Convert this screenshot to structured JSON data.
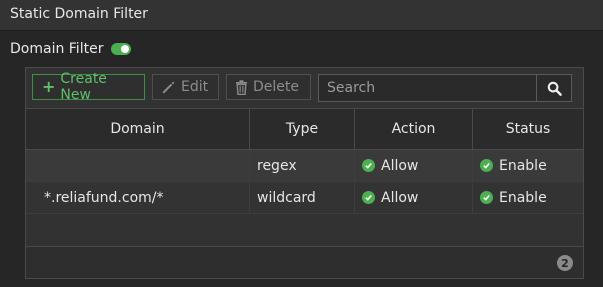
{
  "section": {
    "title": "Static Domain Filter"
  },
  "filter": {
    "label": "Domain Filter",
    "enabled": true
  },
  "toolbar": {
    "create_label": "Create New",
    "edit_label": "Edit",
    "delete_label": "Delete"
  },
  "search": {
    "placeholder": "Search",
    "value": ""
  },
  "table": {
    "columns": [
      "Domain",
      "Type",
      "Action",
      "Status"
    ],
    "rows": [
      {
        "domain": "",
        "type": "regex",
        "action": "Allow",
        "status": "Enable"
      },
      {
        "domain": "*.reliafund.com/*",
        "type": "wildcard",
        "action": "Allow",
        "status": "Enable"
      }
    ]
  },
  "footer": {
    "count": "2"
  },
  "colors": {
    "accent": "#4caf50",
    "background": "#262626"
  }
}
